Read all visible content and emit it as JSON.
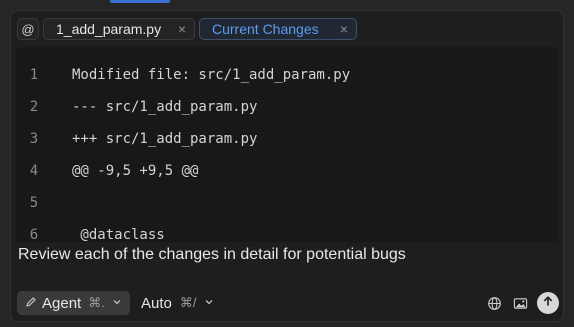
{
  "tabs": {
    "at_symbol": "@",
    "file_tab_label": "1_add_param.py",
    "changes_tab_label": "Current Changes",
    "close_glyph": "×"
  },
  "code": {
    "lines": [
      {
        "num": "1",
        "text": "Modified file: src/1_add_param.py"
      },
      {
        "num": "2",
        "text": "--- src/1_add_param.py"
      },
      {
        "num": "3",
        "text": "+++ src/1_add_param.py"
      },
      {
        "num": "4",
        "text": "@@ -9,5 +9,5 @@"
      },
      {
        "num": "5",
        "text": ""
      },
      {
        "num": "6",
        "text": " @dataclass"
      }
    ]
  },
  "prompt": {
    "text": "Review each of the changes in detail for potential bugs"
  },
  "bottom": {
    "agent_label": "Agent",
    "agent_shortcut": "⌘.",
    "model_label": "Auto",
    "model_shortcut": "⌘/"
  },
  "icons": {
    "pencil": "pencil-icon",
    "globe": "globe-icon",
    "image": "image-icon",
    "send": "arrow-up-icon",
    "chevron": "chevron-down-icon"
  },
  "colors": {
    "accent": "#5b9df0",
    "background": "#1e1e1e"
  }
}
